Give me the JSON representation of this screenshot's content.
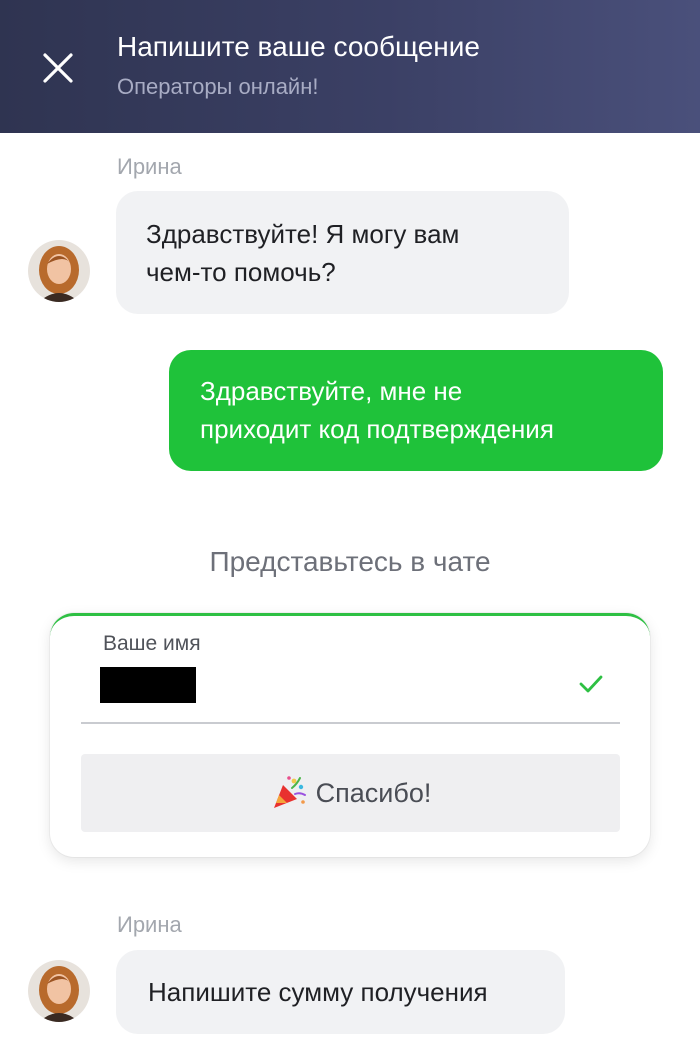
{
  "header": {
    "title": "Напишите ваше сообщение",
    "subtitle": "Операторы онлайн!",
    "close_icon": "close-icon"
  },
  "messages": [
    {
      "sender": "Ирина",
      "text_lines": [
        "Здравствуйте! Я могу вам",
        "чем-то помочь?"
      ]
    },
    {
      "text_lines": [
        "Здравствуйте, мне не",
        "приходит код подтверждения"
      ]
    },
    {
      "sender": "Ирина",
      "text": "Напишите сумму получения"
    }
  ],
  "intro": {
    "heading": "Представьтесь в чате",
    "name_label": "Ваше имя",
    "name_value": "redacted",
    "check_icon": "check-icon",
    "button_icon": "party-popper-icon",
    "button_label": "Спасибо!"
  },
  "colors": {
    "header_bg": "#343a5a",
    "outgoing_bubble": "#1fc23a",
    "incoming_bubble": "#f1f2f4",
    "accent": "#2ec043"
  }
}
